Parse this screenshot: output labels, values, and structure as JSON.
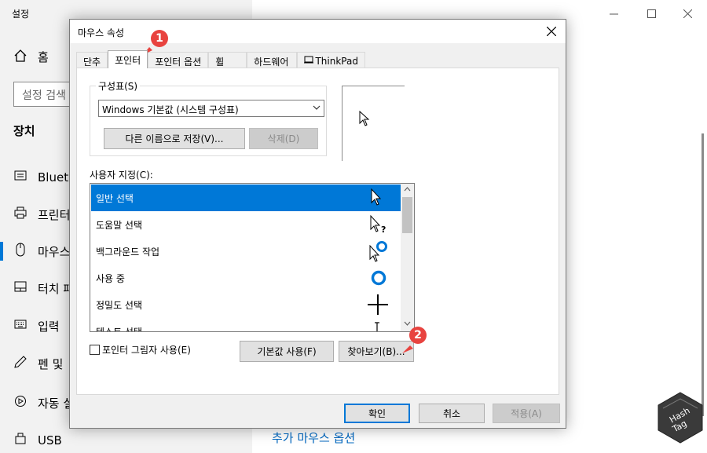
{
  "settings": {
    "title": "설정",
    "home_label": "홈",
    "search_placeholder": "설정 검색",
    "section_title": "장치",
    "nav": [
      {
        "label": "Blueto",
        "icon": "bluetooth-icon"
      },
      {
        "label": "프린터",
        "icon": "printer-icon"
      },
      {
        "label": "마우스",
        "icon": "mouse-icon"
      },
      {
        "label": "터치 패",
        "icon": "touchpad-icon"
      },
      {
        "label": "입력",
        "icon": "keyboard-icon"
      },
      {
        "label": "펜 및",
        "icon": "pen-icon"
      },
      {
        "label": "자동 실",
        "icon": "autoplay-icon"
      },
      {
        "label": "USB",
        "icon": "usb-icon"
      }
    ],
    "more_mouse_options": "추가 마우스 옵션"
  },
  "dialog": {
    "title": "마우스 속성",
    "tabs": [
      "단추",
      "포인터",
      "포인터 옵션",
      "휠",
      "하드웨어",
      "ThinkPad"
    ],
    "active_tab": "포인터",
    "scheme_group_label": "구성표(S)",
    "scheme_value": "Windows 기본값 (시스템 구성표)",
    "save_as_button": "다른 이름으로 저장(V)...",
    "delete_button": "삭제(D)",
    "customize_label": "사용자 지정(C):",
    "cursors": [
      {
        "label": "일반 선택",
        "icon": "arrow-cursor-icon",
        "selected": true
      },
      {
        "label": "도움말 선택",
        "icon": "help-cursor-icon",
        "selected": false
      },
      {
        "label": "백그라운드 작업",
        "icon": "working-cursor-icon",
        "selected": false
      },
      {
        "label": "사용 중",
        "icon": "busy-cursor-icon",
        "selected": false
      },
      {
        "label": "정밀도 선택",
        "icon": "crosshair-cursor-icon",
        "selected": false
      },
      {
        "label": "텍스트 선택",
        "icon": "ibeam-cursor-icon",
        "selected": false
      }
    ],
    "shadow_checkbox_label": "포인터 그림자 사용(E)",
    "shadow_checked": false,
    "default_button": "기본값 사용(F)",
    "browse_button": "찾아보기(B)...",
    "ok_button": "확인",
    "cancel_button": "취소",
    "apply_button": "적용(A)"
  },
  "annotations": {
    "marker_1": "1",
    "marker_2": "2"
  },
  "watermark": {
    "line1": "Hash",
    "line2": "Tag"
  },
  "colors": {
    "accent": "#0078d7",
    "marker": "#e8433f",
    "link": "#0067c0"
  }
}
